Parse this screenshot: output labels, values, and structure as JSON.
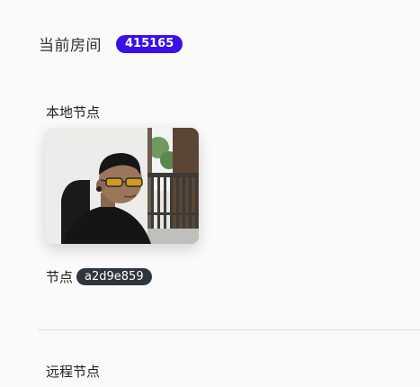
{
  "room": {
    "title": "当前房间",
    "id_badge": "415165",
    "badge_color": "#3b0fe6"
  },
  "local": {
    "heading": "本地节点",
    "video_icon": "camera-feed",
    "node_label": "节点",
    "node_id": "a2d9e859"
  },
  "remote": {
    "heading": "远程节点"
  }
}
